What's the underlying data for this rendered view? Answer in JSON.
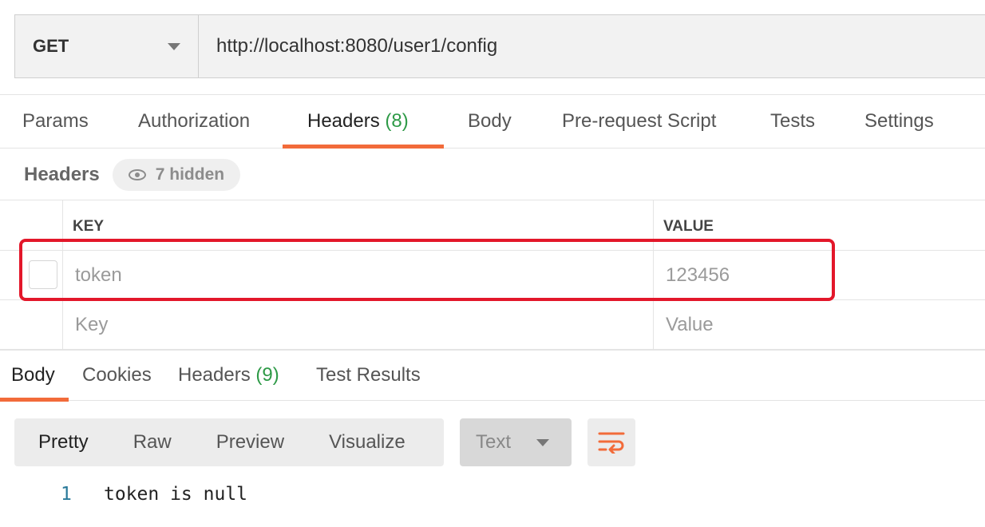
{
  "request": {
    "method": "GET",
    "url": "http://localhost:8080/user1/config"
  },
  "request_tabs": [
    {
      "label": "Params",
      "count": null
    },
    {
      "label": "Authorization",
      "count": null
    },
    {
      "label": "Headers",
      "count": "(8)",
      "active": true
    },
    {
      "label": "Body",
      "count": null
    },
    {
      "label": "Pre-request Script",
      "count": null
    },
    {
      "label": "Tests",
      "count": null
    },
    {
      "label": "Settings",
      "count": null
    }
  ],
  "headers_panel": {
    "title": "Headers",
    "hidden_label": "7 hidden",
    "columns": {
      "key": "KEY",
      "value": "VALUE"
    },
    "rows": [
      {
        "key": "token",
        "value": "123456",
        "checked": false
      }
    ],
    "new_row": {
      "key_placeholder": "Key",
      "value_placeholder": "Value"
    }
  },
  "response_tabs": [
    {
      "label": "Body",
      "count": null,
      "active": true
    },
    {
      "label": "Cookies",
      "count": null
    },
    {
      "label": "Headers",
      "count": "(9)"
    },
    {
      "label": "Test Results",
      "count": null
    }
  ],
  "response_toolbar": {
    "view_modes": [
      "Pretty",
      "Raw",
      "Preview",
      "Visualize"
    ],
    "active_view": "Pretty",
    "format": "Text",
    "wrap_icon": "wrap-lines-icon"
  },
  "response_body": {
    "lines": [
      {
        "number": "1",
        "text": "token is null"
      }
    ]
  },
  "colors": {
    "accent": "#f26b3a",
    "count": "#2e9a47",
    "highlight": "#e3172a"
  }
}
